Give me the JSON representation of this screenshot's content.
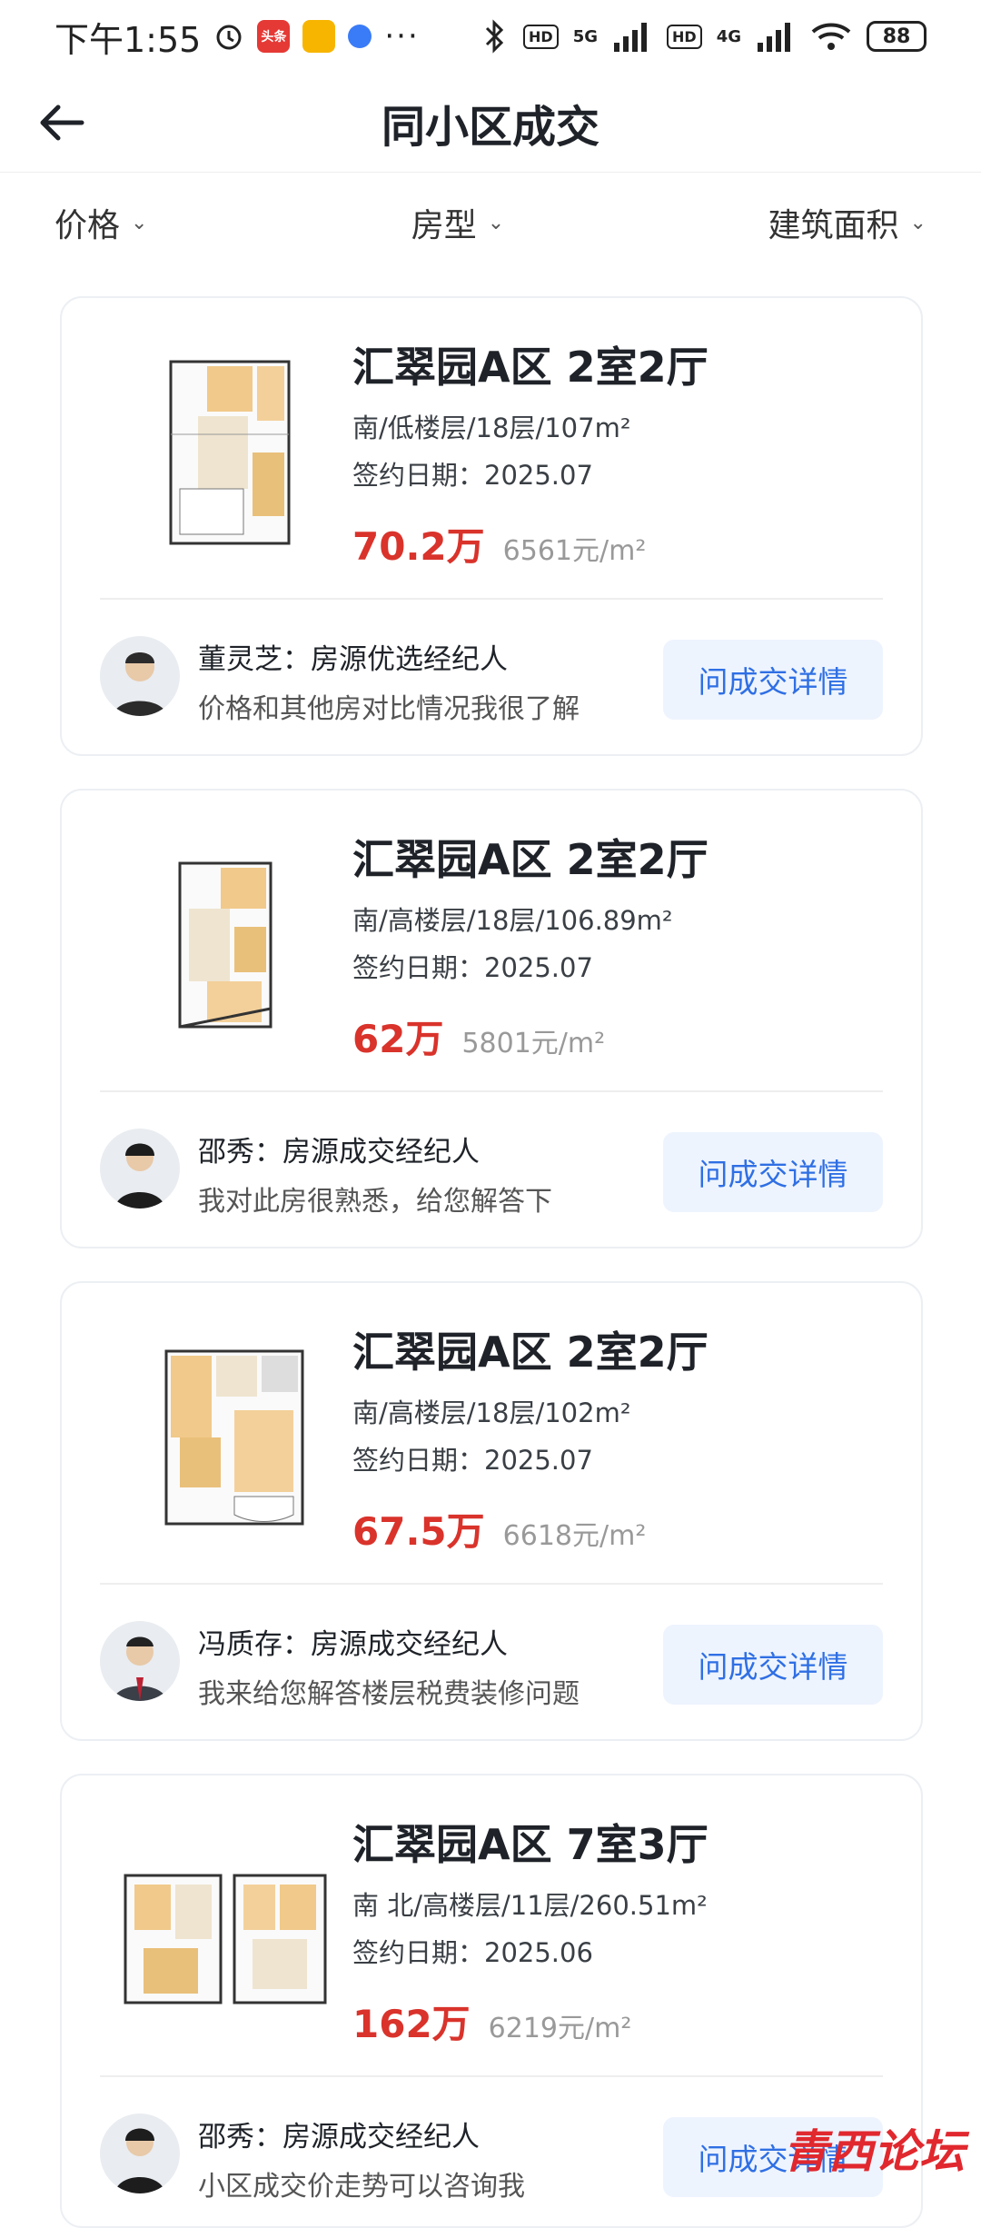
{
  "status_bar": {
    "time": "下午1:55",
    "app_badges": [
      "头条"
    ],
    "dots": "···",
    "network_1": "5G",
    "network_2": "4G",
    "hd_label": "HD",
    "battery": "88"
  },
  "nav": {
    "title": "同小区成交"
  },
  "filters": [
    {
      "label": "价格"
    },
    {
      "label": "房型"
    },
    {
      "label": "建筑面积"
    }
  ],
  "listings": [
    {
      "title": "汇翠园A区 2室2厅",
      "desc": "南/低楼层/18层/107m²",
      "date": "签约日期：2025.07",
      "price": "70.2万",
      "unit_price": "6561元/m²",
      "agent_name": "董灵芝：房源优选经纪人",
      "agent_note": "价格和其他房对比情况我很了解",
      "button": "问成交详情"
    },
    {
      "title": "汇翠园A区 2室2厅",
      "desc": "南/高楼层/18层/106.89m²",
      "date": "签约日期：2025.07",
      "price": "62万",
      "unit_price": "5801元/m²",
      "agent_name": "邵秀：房源成交经纪人",
      "agent_note": "我对此房很熟悉，给您解答下",
      "button": "问成交详情"
    },
    {
      "title": "汇翠园A区 2室2厅",
      "desc": "南/高楼层/18层/102m²",
      "date": "签约日期：2025.07",
      "price": "67.5万",
      "unit_price": "6618元/m²",
      "agent_name": "冯质存：房源成交经纪人",
      "agent_note": "我来给您解答楼层税费装修问题",
      "button": "问成交详情"
    },
    {
      "title": "汇翠园A区 7室3厅",
      "desc": "南 北/高楼层/11层/260.51m²",
      "date": "签约日期：2025.06",
      "price": "162万",
      "unit_price": "6219元/m²",
      "agent_name": "邵秀：房源成交经纪人",
      "agent_note": "小区成交价走势可以咨询我",
      "button": "问成交详情"
    }
  ],
  "watermark": "青西论坛",
  "colors": {
    "price": "#d9332b",
    "button_text": "#2f6fe4",
    "button_bg": "#eef4fe"
  }
}
